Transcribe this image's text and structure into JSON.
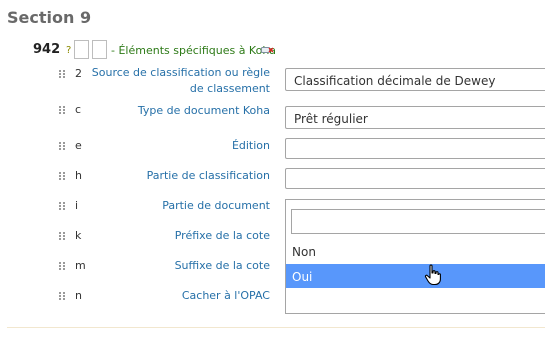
{
  "section": {
    "title": "Section 9"
  },
  "tag": {
    "number": "942",
    "help": "?",
    "label": "- Éléments spécifiques à Koha",
    "icon": "delete-field-icon"
  },
  "subfields": [
    {
      "code": "2",
      "label_line1": "Source de classification ou règle",
      "label_line2": "de classement",
      "value": "Classification décimale de Dewey"
    },
    {
      "code": "c",
      "label": "Type de document Koha",
      "value": "Prêt régulier"
    },
    {
      "code": "e",
      "label": "Édition",
      "value": ""
    },
    {
      "code": "h",
      "label": "Partie de classification",
      "value": ""
    },
    {
      "code": "i",
      "label": "Partie de document"
    },
    {
      "code": "k",
      "label": "Préfixe de la cote"
    },
    {
      "code": "m",
      "label": "Suffixe de la cote"
    },
    {
      "code": "n",
      "label": "Cacher à l'OPAC"
    }
  ],
  "dropdown": {
    "search_value": "",
    "options": [
      "Non",
      "Oui"
    ],
    "highlighted": "Oui"
  },
  "colors": {
    "section_title": "#696969",
    "tag_label": "#2d7a17",
    "subfield_label": "#2670a8",
    "highlight": "#5897fb"
  }
}
